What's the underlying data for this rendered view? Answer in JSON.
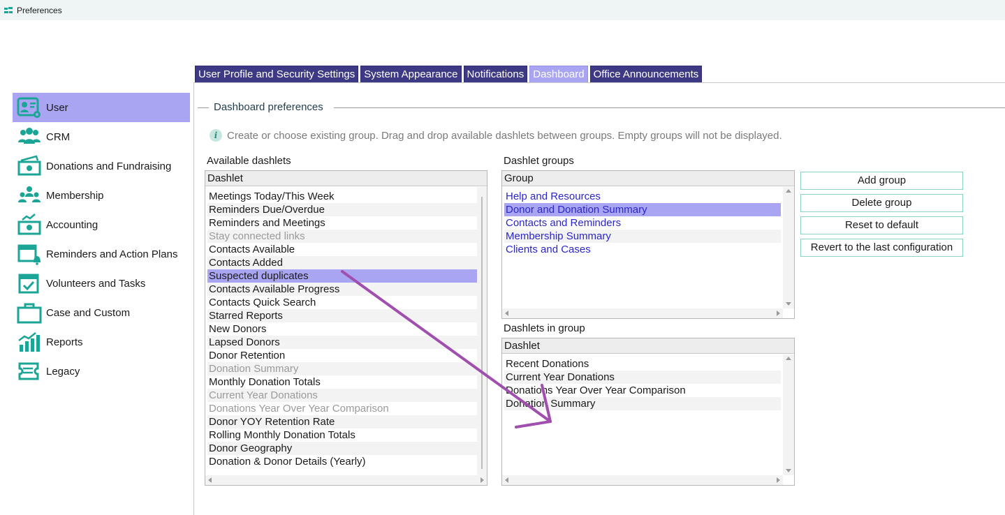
{
  "window": {
    "title": "Preferences"
  },
  "tabs": [
    {
      "label": "User Profile and Security Settings",
      "active": false
    },
    {
      "label": "System Appearance",
      "active": false
    },
    {
      "label": "Notifications",
      "active": false
    },
    {
      "label": "Dashboard",
      "active": true
    },
    {
      "label": "Office Announcements",
      "active": false
    }
  ],
  "sidebar": {
    "items": [
      {
        "label": "User",
        "icon": "user-card-icon",
        "active": true
      },
      {
        "label": "CRM",
        "icon": "people-icon",
        "active": false
      },
      {
        "label": "Donations and Fundraising",
        "icon": "money-icon",
        "active": false
      },
      {
        "label": "Membership",
        "icon": "group-icon",
        "active": false
      },
      {
        "label": "Accounting",
        "icon": "accounting-icon",
        "active": false
      },
      {
        "label": "Reminders and Action Plans",
        "icon": "calendar-bell-icon",
        "active": false
      },
      {
        "label": "Volunteers and Tasks",
        "icon": "calendar-check-icon",
        "active": false
      },
      {
        "label": "Case and Custom",
        "icon": "briefcase-icon",
        "active": false
      },
      {
        "label": "Reports",
        "icon": "bar-chart-icon",
        "active": false
      },
      {
        "label": "Legacy",
        "icon": "ticket-icon",
        "active": false
      }
    ]
  },
  "dashboard": {
    "legend": "Dashboard preferences",
    "info": "Create or choose existing group. Drag and drop available dashlets between groups. Empty groups will not be displayed.",
    "available": {
      "label": "Available dashlets",
      "header": "Dashlet",
      "items": [
        {
          "label": "Meetings Today/This Week",
          "state": "normal"
        },
        {
          "label": "Reminders Due/Overdue",
          "state": "normal"
        },
        {
          "label": "Reminders and Meetings",
          "state": "normal"
        },
        {
          "label": "Stay connected links",
          "state": "dim"
        },
        {
          "label": "Contacts Available",
          "state": "normal"
        },
        {
          "label": "Contacts Added",
          "state": "normal"
        },
        {
          "label": "Suspected duplicates",
          "state": "selected"
        },
        {
          "label": "Contacts Available Progress",
          "state": "normal"
        },
        {
          "label": "Contacts Quick Search",
          "state": "normal"
        },
        {
          "label": "Starred Reports",
          "state": "normal"
        },
        {
          "label": "New Donors",
          "state": "normal"
        },
        {
          "label": "Lapsed Donors",
          "state": "normal"
        },
        {
          "label": "Donor Retention",
          "state": "normal"
        },
        {
          "label": "Donation Summary",
          "state": "dim"
        },
        {
          "label": "Monthly Donation Totals",
          "state": "normal"
        },
        {
          "label": "Current Year Donations",
          "state": "dim"
        },
        {
          "label": "Donations Year Over Year Comparison",
          "state": "dim"
        },
        {
          "label": "Donor YOY Retention Rate",
          "state": "normal"
        },
        {
          "label": "Rolling Monthly Donation Totals",
          "state": "normal"
        },
        {
          "label": "Donor Geography",
          "state": "normal"
        },
        {
          "label": "Donation & Donor Details (Yearly)",
          "state": "normal"
        }
      ]
    },
    "groups": {
      "label": "Dashlet groups",
      "header": "Group",
      "items": [
        {
          "label": "Help and Resources",
          "state": "link"
        },
        {
          "label": "Donor and Donation Summary",
          "state": "selected"
        },
        {
          "label": "Contacts and Reminders",
          "state": "link"
        },
        {
          "label": "Membership Summary",
          "state": "link"
        },
        {
          "label": "Clients and Cases",
          "state": "link"
        }
      ]
    },
    "in_group": {
      "label": "Dashlets in group",
      "header": "Dashlet",
      "items": [
        {
          "label": "Recent Donations",
          "state": "normal"
        },
        {
          "label": "Current Year Donations",
          "state": "normal"
        },
        {
          "label": "Donations Year Over Year Comparison",
          "state": "normal"
        },
        {
          "label": "Donation Summary",
          "state": "normal"
        }
      ]
    },
    "buttons": {
      "add_group": "Add group",
      "delete_group": "Delete group",
      "reset_default": "Reset to default",
      "revert_last": "Revert to the last configuration"
    }
  },
  "colors": {
    "tab_bg": "#3d3984",
    "tab_active_bg": "#a9a5f2",
    "selection": "#a9a5f2",
    "accent_teal": "#1aa596",
    "link": "#2a27c9",
    "annotation_arrow": "#a04fae"
  }
}
